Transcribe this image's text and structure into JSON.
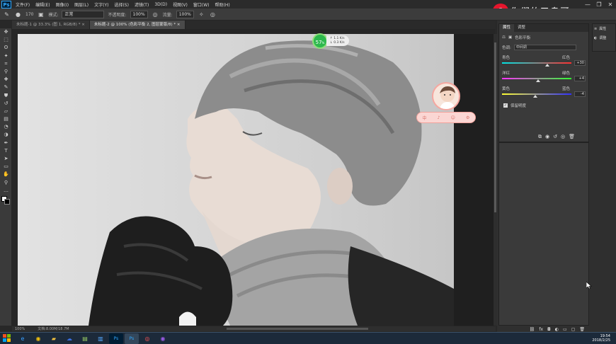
{
  "app": {
    "logo": "Ps"
  },
  "menubar": {
    "items": [
      "文件(F)",
      "编辑(E)",
      "图像(I)",
      "图层(L)",
      "文字(Y)",
      "选择(S)",
      "滤镜(T)",
      "3D(D)",
      "视图(V)",
      "窗口(W)",
      "帮助(H)"
    ],
    "window_controls": [
      "—",
      "❐",
      "✕"
    ]
  },
  "watermark": {
    "logo_icon": "weibo-icon",
    "text": "你们的又鸟哥"
  },
  "options": {
    "brush_size": "170",
    "mode_label": "模式:",
    "mode_value": "正常",
    "opacity_label": "不透明度:",
    "opacity_value": "100%",
    "flow_label": "流量:",
    "flow_value": "100%"
  },
  "tabs": [
    {
      "label": "未标题-1 @ 33.3% (图 1, RGB/8) *",
      "close": "×"
    },
    {
      "label": "未标题-2 @ 100% (色彩平衡 2, 图层蒙版/8) *",
      "close": "×"
    }
  ],
  "tools": [
    "move-icon",
    "marquee-icon",
    "lasso-icon",
    "magic-wand-icon",
    "crop-icon",
    "eyedropper-icon",
    "healing-icon",
    "brush-icon",
    "stamp-icon",
    "history-brush-icon",
    "eraser-icon",
    "gradient-icon",
    "blur-icon",
    "dodge-icon",
    "pen-icon",
    "text-icon",
    "path-select-icon",
    "shape-icon",
    "hand-icon",
    "zoom-icon",
    "more-icon"
  ],
  "perf": {
    "percent": "57",
    "unit": "%",
    "up": "↑ 1.1 K/s",
    "down": "↓ 0.3 K/s"
  },
  "pink_widget": {
    "buttons": [
      "中",
      "♪",
      "☺",
      "⚙"
    ]
  },
  "properties": {
    "tabs": [
      "属性",
      "调整"
    ],
    "title": "色彩平衡",
    "tone_label": "色调:",
    "tone_value": "中间调",
    "rows": [
      {
        "left": "青色",
        "right": "红色",
        "value": "+30",
        "level": 0.65
      },
      {
        "left": "洋红",
        "right": "绿色",
        "value": "+4",
        "level": 0.52
      },
      {
        "left": "黄色",
        "right": "蓝色",
        "value": "-4",
        "level": 0.48
      }
    ],
    "preserve_label": "保留明度",
    "preserve_checked": true,
    "bottom_icons": [
      "clip-icon",
      "eye-prev-icon",
      "reset-icon",
      "visibility-icon",
      "trash-icon"
    ]
  },
  "layers_bar": {
    "icons": [
      "link-icon",
      "fx-icon",
      "mask-icon",
      "adjust-icon",
      "folder-icon",
      "new-layer-icon",
      "trash-icon"
    ],
    "fx_label": "fx"
  },
  "right_sidebar": {
    "items": [
      {
        "icon": "properties-icon",
        "label": "属性"
      },
      {
        "icon": "adjust-icon",
        "label": "调整"
      }
    ]
  },
  "status": {
    "zoom": "100%",
    "doc": "文档:8.00M/18.7M"
  },
  "taskbar": {
    "apps": [
      "ie-icon",
      "chrome-icon",
      "folder-icon",
      "baidu-icon",
      "archive-icon",
      "files-icon",
      "photoshop-icon",
      "photoshop-icon-2",
      "app-icon",
      "chrome-icon-2"
    ],
    "time": "19:54",
    "date": "2018/2/25"
  },
  "colors": {
    "accent": "#31a8ff",
    "perf_green": "#2db84d",
    "weibo_red": "#e6162d",
    "pink": "#fbd6d3"
  }
}
